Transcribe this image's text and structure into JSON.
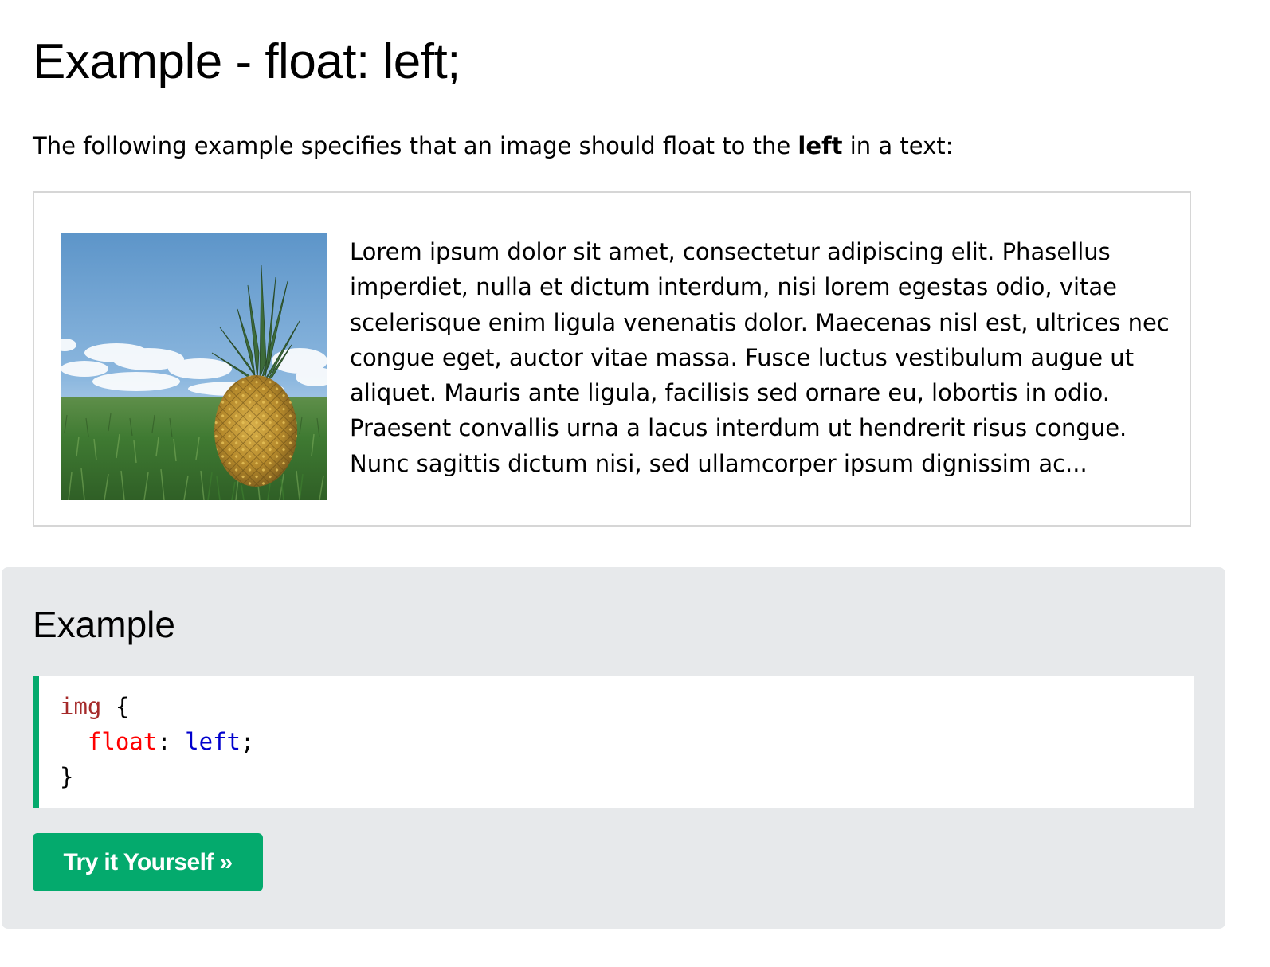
{
  "page": {
    "title": "Example - float: left;",
    "intro_before": "The following example specifies that an image should float to the ",
    "intro_bold": "left",
    "intro_after": " in a text:"
  },
  "demo": {
    "image_alt": "Pineapple",
    "paragraph": "Lorem ipsum dolor sit amet, consectetur adipiscing elit. Phasellus imperdiet, nulla et dictum interdum, nisi lorem egestas odio, vitae scelerisque enim ligula venenatis dolor. Maecenas nisl est, ultrices nec congue eget, auctor vitae massa. Fusce luctus vestibulum augue ut aliquet. Mauris ante ligula, facilisis sed ornare eu, lobortis in odio. Praesent convallis urna a lacus interdum ut hendrerit risus congue. Nunc sagittis dictum nisi, sed ullamcorper ipsum dignissim ac..."
  },
  "example": {
    "heading": "Example",
    "code": {
      "selector": "img",
      "open_brace": " {",
      "indent": "  ",
      "property": "float",
      "colon": ": ",
      "value": "left",
      "semicolon": ";",
      "close_brace": "}"
    },
    "button_label": "Try it Yourself »"
  },
  "colors": {
    "accent": "#04aa6d",
    "panel_bg": "#e7e9eb",
    "border": "#d6d6d6",
    "selector": "#a52a2a",
    "property": "#ff0000",
    "value": "#0000cd"
  }
}
